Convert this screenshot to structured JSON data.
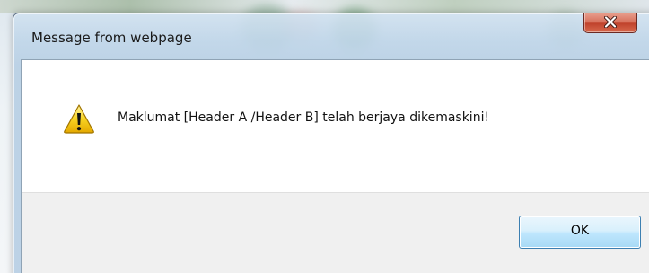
{
  "dialog": {
    "title": "Message from webpage",
    "close_icon": "close-icon",
    "message": "Maklumat [Header A /Header B] telah berjaya dikemaskini!",
    "message_icon": "warning-icon",
    "ok_label": "OK"
  },
  "colors": {
    "close_button": "#c7503a",
    "ok_button_border": "#3c7fb1",
    "warning_yellow": "#f5c400"
  }
}
